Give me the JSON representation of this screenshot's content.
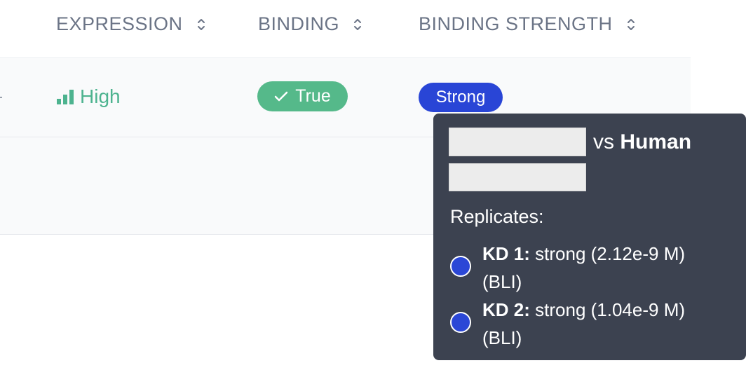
{
  "table": {
    "headers": {
      "expression": "EXPRESSION",
      "binding": "BINDING",
      "binding_strength": "BINDING STRENGTH"
    },
    "row": {
      "expression": "High",
      "binding": "True",
      "binding_strength": "Strong"
    }
  },
  "tooltip": {
    "vs_prefix": "vs",
    "species": "Human",
    "replicates_label": "Replicates:",
    "replicates": [
      {
        "key": "KD 1:",
        "value": "strong (2.12e-9 M) (BLI)",
        "color": "#2b47d6"
      },
      {
        "key": "KD 2:",
        "value": "strong (1.04e-9 M) (BLI)",
        "color": "#2b47d6"
      }
    ]
  },
  "colors": {
    "expression_high": "#4db38f",
    "binding_true": "#55b98a",
    "strength_strong": "#2945d6",
    "tooltip_bg": "#3c4250"
  }
}
